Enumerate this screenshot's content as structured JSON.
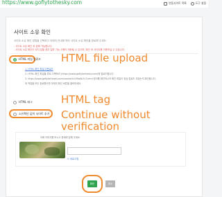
{
  "url": "https://www.gofiytothesky.com",
  "top_links": [
    {
      "label": "연동사이트 목록",
      "icon": "list-icon"
    },
    {
      "label": "도구 설정",
      "icon": "gear-icon"
    }
  ],
  "title": "사이트 소유 확인",
  "description": "사이트 소유 확인 방법을 선택하고 아래의 안내에 따라 사이트 소유 확인을 완료해 주세요.",
  "notices": [
    "- 사이트 소유 확인 후 등록 가능합니다.",
    "- 사이트 소유 확인이 되지 않을 경우 일부 기능 사용이 제한될 수 있으며, 확인 후 사이트를 이용하실 수 있습니다."
  ],
  "options": {
    "html_file": "HTML 파일 업로드",
    "html_tag": "HTML 태그",
    "skip": "소유확인 없이 사이트 추가"
  },
  "html_file_steps": [
    "1. HTML 확인 파일 다운로드",
    "2. HTML 확인 파일을 루트 디렉토리 (https://www.gofiytothesky.com)에 업로드합니다.",
    "3. https://www.gofiytothesky.com/naverd1e2f9a0b7c3.html 링크를 확인하시어 확인 파일이 정상 업로드 되었는지 확인합니다.",
    "위 작업을 모두 완료했으면 아래의 확인 버튼을 클릭하세요."
  ],
  "captcha": {
    "line1": "아래 이미지를 보시고 문제에 답해 주세요.",
    "line2": "",
    "refresh_label": "새로고침"
  },
  "buttons": {
    "confirm": "확인",
    "cancel": "취소"
  },
  "annotations": {
    "html_file_upload": "HTML file upload",
    "html_tag": "HTML tag",
    "continue_line1": "Continue without",
    "continue_line2": "verification"
  },
  "colors": {
    "brand_green": "#2ea44f",
    "annotation_orange": "#f08a2e",
    "notice_red": "#e05a5a"
  }
}
